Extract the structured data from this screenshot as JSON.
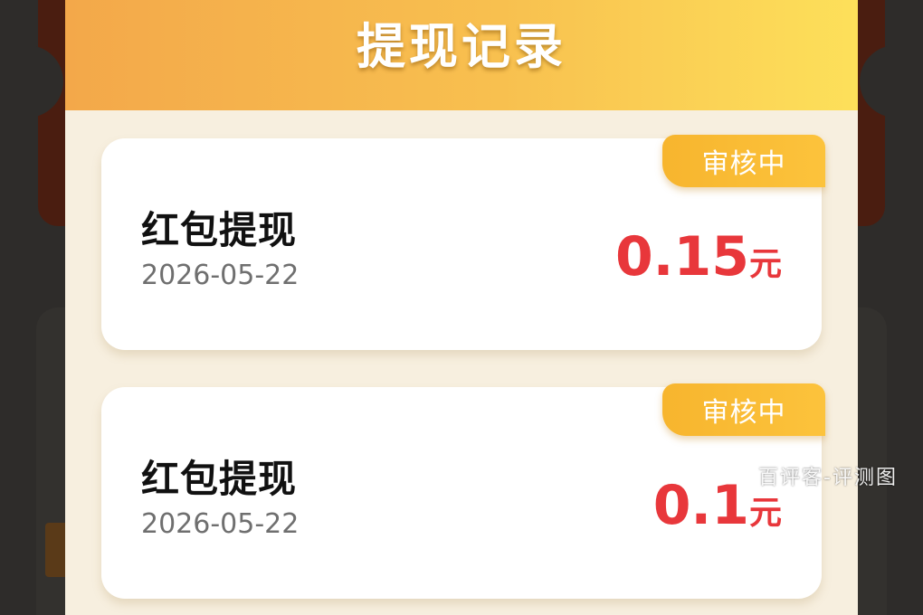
{
  "modal": {
    "title": "提现记录"
  },
  "records": [
    {
      "title": "红包提现",
      "date": "2026-05-22",
      "amount": "0.15",
      "unit": "元",
      "status": "审核中"
    },
    {
      "title": "红包提现",
      "date": "2026-05-22",
      "amount": "0.1",
      "unit": "元",
      "status": "审核中"
    }
  ],
  "watermark": "百评客-评测图",
  "colors": {
    "header_gradient_start": "#f3a84a",
    "header_gradient_end": "#fde05a",
    "badge": "#f8b830",
    "amount": "#e8373b",
    "modal_background": "#f7efdf"
  }
}
